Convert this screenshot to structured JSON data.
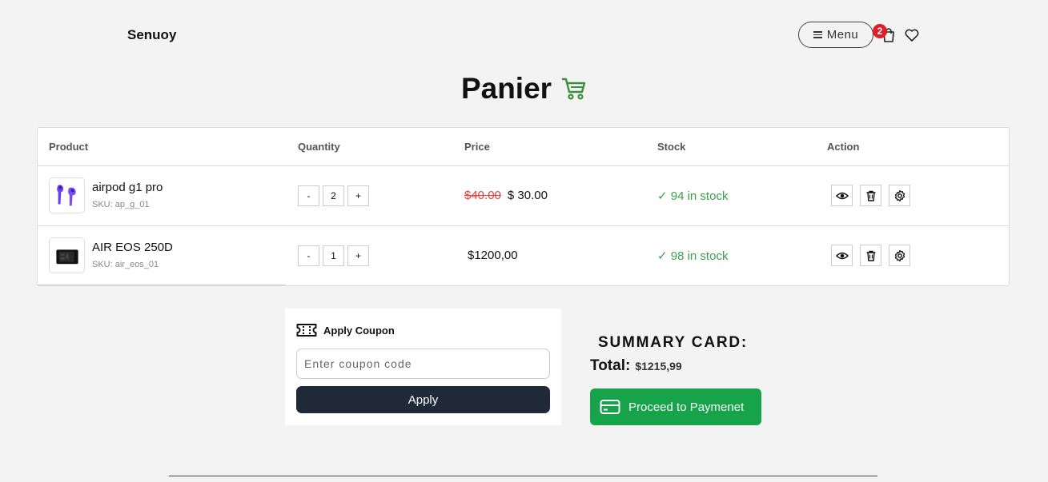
{
  "header": {
    "brand": "Senuoy",
    "menu_label": "Menu",
    "cart_count": "2",
    "icons": [
      "menu-icon",
      "shopping-bag-icon",
      "heart-icon"
    ]
  },
  "page": {
    "title": "Panier",
    "title_icon": "shopping-cart-icon",
    "accent_color": "#3a8f3a"
  },
  "table": {
    "columns": [
      "Product",
      "Quantity",
      "Price",
      "Stock",
      "Action"
    ],
    "rows": [
      {
        "name": "airpod g1 pro",
        "sku": "SKU: ap_g_01",
        "quantity": "2",
        "old_price": "$40.00",
        "price": "$ 30.00",
        "stock": "✓ 94 in stock",
        "thumb": "airpods-image"
      },
      {
        "name": "AIR EOS 250D",
        "sku": "SKU: air_eos_01",
        "quantity": "1",
        "old_price": "",
        "price": "$1200,00",
        "stock": "✓ 98 in stock",
        "thumb": "camera-image"
      }
    ],
    "minus_label": "-",
    "plus_label": "+",
    "actions": [
      "eye-icon",
      "trash-icon",
      "gear-icon"
    ],
    "stock_color": "#3aa14a",
    "old_price_color": "#e0443c"
  },
  "coupon": {
    "title": "Apply Coupon",
    "placeholder": "Enter coupon code",
    "value": "",
    "apply_label": "Apply",
    "icon": "ticket-icon"
  },
  "summary": {
    "title": "SUMMARY CARD:",
    "total_label": "Total:",
    "total_value": "$1215,99",
    "pay_label": "Proceed to Paymenet",
    "pay_icon": "credit-card-icon",
    "pay_color": "#16a34a"
  }
}
